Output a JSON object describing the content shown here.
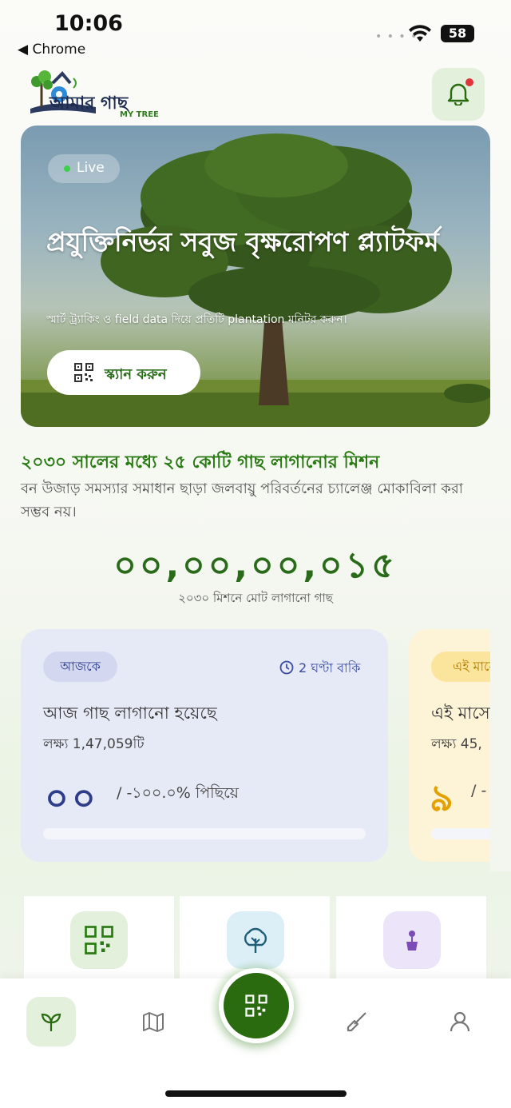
{
  "status_bar": {
    "time": "10:06",
    "back_app": "◀ Chrome",
    "battery": "58"
  },
  "header": {
    "logo_text": "আমার গাছ",
    "logo_sub": "MY TREE",
    "bell_icon": "bell-icon"
  },
  "hero": {
    "live_label": "Live",
    "title": "প্রযুক্তিনির্ভর সবুজ বৃক্ষরোপণ প্ল্যাটফর্ম",
    "subtitle": "স্মার্ট ট্র্যাকিং ও field data দিয়ে প্রতিটি plantation মনিটর করুন।",
    "scan_button": "স্ক্যান করুন"
  },
  "mission": {
    "title": "২০৩০ সালের মধ্যে ২৫ কোটি গাছ লাগানোর মিশন",
    "description": "বন উজাড় সমস্যার সমাধান ছাড়া জলবায়ু পরিবর্তনের চ্যালেঞ্জ মোকাবিলা করা সম্ভব নয়।",
    "counter": "০০,০০,০০,০১৫",
    "counter_label": "২০৩০ মিশনে মোট লাগানো গাছ"
  },
  "cards": {
    "today": {
      "pill": "আজকে",
      "time_left": "2 ঘণ্টা বাকি",
      "heading": "আজ গাছ লাগানো হয়েছে",
      "target": "লক্ষ্য 1,47,059টি",
      "count": "০০",
      "progress": "/ -১০০.০% পিছিয়ে"
    },
    "month": {
      "pill": "এই মাসে",
      "heading": "এই মাসে",
      "target": "লক্ষ্য 45,",
      "count": "৯",
      "progress": "/ -"
    }
  },
  "quick_actions": [
    "qr-code-icon",
    "tree-icon",
    "plant-pot-icon"
  ],
  "bottom_nav": [
    "sprout-icon",
    "map-icon",
    "qr-scan-icon",
    "shovel-icon",
    "user-icon"
  ],
  "colors": {
    "brand_green": "#2a6b10",
    "accent_green": "#2a7a14",
    "today_blue": "#2d3d8a",
    "month_amber": "#e3a100",
    "notification_red": "#e0333a"
  }
}
